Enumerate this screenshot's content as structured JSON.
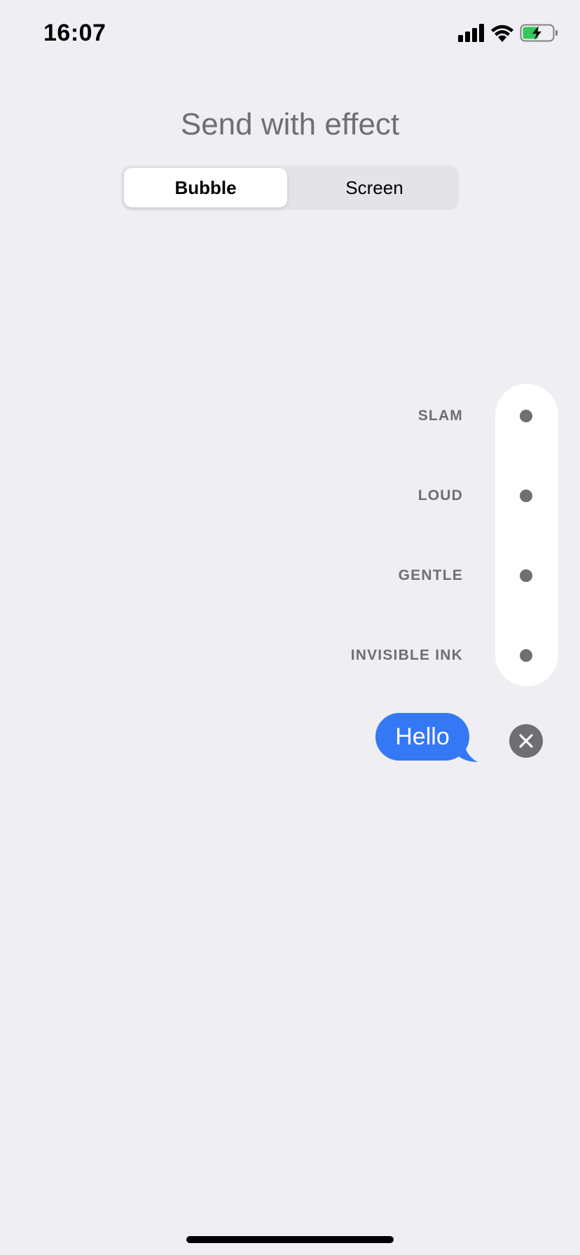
{
  "status_bar": {
    "time": "16:07",
    "icons": [
      "cellular-signal-icon",
      "wifi-icon",
      "battery-charging-icon"
    ],
    "battery_color": "#34C759"
  },
  "title": "Send with effect",
  "segmented_control": {
    "options": [
      "Bubble",
      "Screen"
    ],
    "selected": "Bubble"
  },
  "effects": [
    {
      "label": "SLAM"
    },
    {
      "label": "LOUD"
    },
    {
      "label": "GENTLE"
    },
    {
      "label": "INVISIBLE INK"
    }
  ],
  "message": {
    "text": "Hello",
    "bubble_color": "#3478F6"
  },
  "close_icon": "close-icon"
}
